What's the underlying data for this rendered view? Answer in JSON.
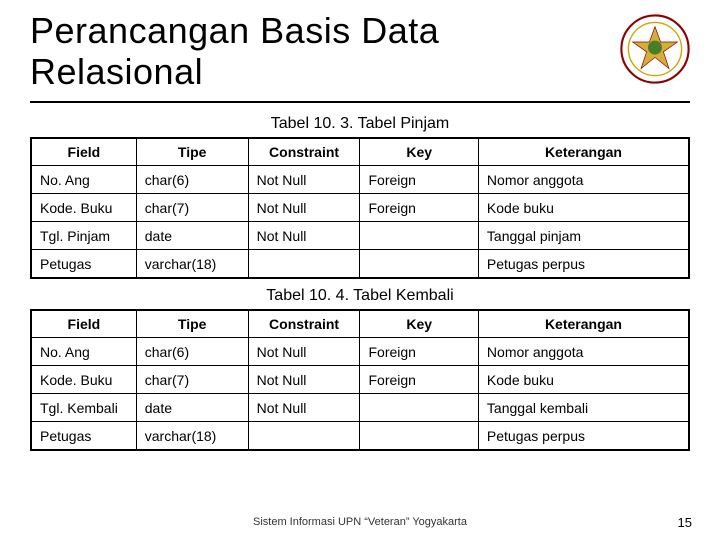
{
  "title": "Perancangan Basis Data Relasional",
  "captions": {
    "t1": "Tabel 10. 3. Tabel Pinjam",
    "t2": "Tabel 10. 4. Tabel Kembali"
  },
  "headers": {
    "field": "Field",
    "tipe": "Tipe",
    "constraint": "Constraint",
    "key": "Key",
    "ket": "Keterangan"
  },
  "table1": {
    "rows": [
      {
        "field": "No. Ang",
        "tipe": "char(6)",
        "constraint": "Not Null",
        "key": "Foreign",
        "ket": "Nomor anggota"
      },
      {
        "field": "Kode. Buku",
        "tipe": "char(7)",
        "constraint": "Not Null",
        "key": "Foreign",
        "ket": "Kode buku"
      },
      {
        "field": "Tgl. Pinjam",
        "tipe": "date",
        "constraint": "Not Null",
        "key": "",
        "ket": "Tanggal pinjam"
      },
      {
        "field": "Petugas",
        "tipe": "varchar(18)",
        "constraint": "",
        "key": "",
        "ket": "Petugas perpus"
      }
    ]
  },
  "table2": {
    "rows": [
      {
        "field": "No. Ang",
        "tipe": "char(6)",
        "constraint": "Not Null",
        "key": "Foreign",
        "ket": "Nomor anggota"
      },
      {
        "field": "Kode. Buku",
        "tipe": "char(7)",
        "constraint": "Not Null",
        "key": "Foreign",
        "ket": "Kode buku"
      },
      {
        "field": "Tgl. Kembali",
        "tipe": "date",
        "constraint": "Not Null",
        "key": "",
        "ket": "Tanggal kembali"
      },
      {
        "field": "Petugas",
        "tipe": "varchar(18)",
        "constraint": "",
        "key": "",
        "ket": "Petugas perpus"
      }
    ]
  },
  "footer": "Sistem Informasi UPN “Veteran” Yogyakarta",
  "pagenum": "15"
}
